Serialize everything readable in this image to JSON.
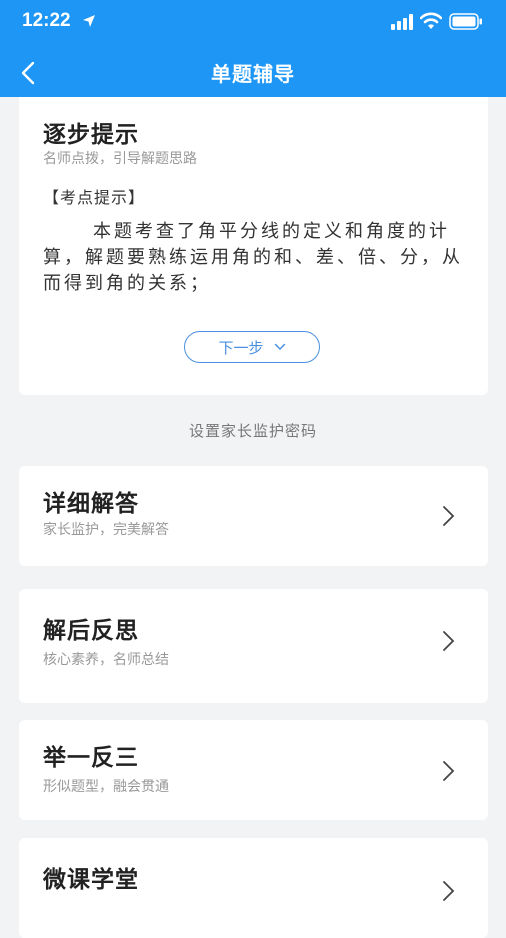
{
  "status_bar": {
    "time": "12:22"
  },
  "nav": {
    "title": "单题辅导"
  },
  "hint_card": {
    "title": "逐步提示",
    "subtitle": "名师点拨，引导解题思路",
    "tag": "【考点提示】",
    "body": "本题考查了角平分线的定义和角度的计算，解题要熟练运用角的和、差、倍、分，从而得到角的关系；",
    "next_label": "下一步"
  },
  "parent_link": "设置家长监护密码",
  "menu": [
    {
      "title": "详细解答",
      "subtitle": "家长监护，完美解答"
    },
    {
      "title": "解后反思",
      "subtitle": "核心素养，名师总结"
    },
    {
      "title": "举一反三",
      "subtitle": "形似题型，融会贯通"
    },
    {
      "title": "微课学堂",
      "subtitle": ""
    }
  ],
  "colors": {
    "primary": "#1e96f5",
    "accent": "#4a90e2",
    "background": "#f2f3f5"
  }
}
